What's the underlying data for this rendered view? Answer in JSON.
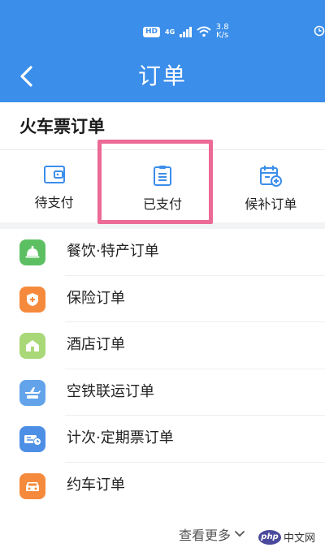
{
  "colors": {
    "brand": "#3b8eea",
    "highlight": "#ec6a96",
    "food": "#5cc063",
    "insurance": "#f58a3c",
    "hotel": "#a8d877",
    "air_rail": "#62a3ea",
    "pass": "#4e8fe6",
    "car": "#f58a3c"
  },
  "status_bar": {
    "hd": "HD",
    "network": "4G",
    "speed_value": "3.8",
    "speed_unit": "K/s"
  },
  "nav": {
    "title": "订单",
    "back_icon": "chevron-left-icon"
  },
  "train_orders": {
    "title": "火车票订单",
    "tabs": [
      {
        "label": "待支付",
        "icon": "wallet-icon"
      },
      {
        "label": "已支付",
        "icon": "clipboard-list-icon"
      },
      {
        "label": "候补订单",
        "icon": "calendar-add-icon"
      }
    ]
  },
  "other_orders": [
    {
      "label": "餐饮·特产订单",
      "icon": "food-bell-icon"
    },
    {
      "label": "保险订单",
      "icon": "shield-plus-icon"
    },
    {
      "label": "酒店订单",
      "icon": "hotel-icon"
    },
    {
      "label": "空铁联运订单",
      "icon": "plane-train-icon"
    },
    {
      "label": "计次·定期票订单",
      "icon": "ticket-pass-icon"
    },
    {
      "label": "约车订单",
      "icon": "car-icon"
    }
  ],
  "more": {
    "label": "查看更多",
    "icon": "chevron-down-icon"
  },
  "watermark": {
    "badge": "php",
    "text": "中文网"
  }
}
